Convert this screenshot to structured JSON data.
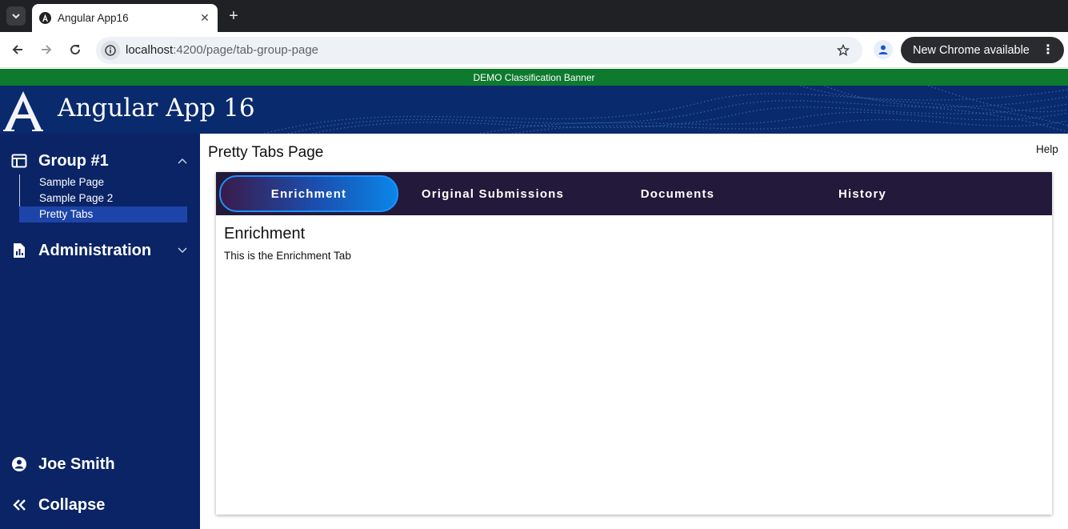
{
  "browser": {
    "tab_title": "Angular App16",
    "url_host": "localhost",
    "url_rest": ":4200/page/tab-group-page",
    "update_label": "New Chrome available"
  },
  "banner": {
    "text": "DEMO Classification Banner"
  },
  "header": {
    "title": "Angular App 16"
  },
  "sidebar": {
    "groups": [
      {
        "label": "Group #1",
        "icon": "dashboard-icon",
        "expanded": true,
        "items": [
          {
            "label": "Sample Page"
          },
          {
            "label": "Sample Page 2"
          },
          {
            "label": "Pretty Tabs",
            "active": true
          }
        ]
      },
      {
        "label": "Administration",
        "icon": "report-icon",
        "expanded": false
      }
    ],
    "user": {
      "label": "Joe Smith",
      "icon": "account-circle-icon"
    },
    "collapse": {
      "label": "Collapse",
      "icon": "double-chevron-left-icon"
    }
  },
  "page": {
    "title": "Pretty Tabs Page",
    "help_label": "Help"
  },
  "tabs": {
    "items": [
      {
        "label": "Enrichment",
        "active": true
      },
      {
        "label": "Original Submissions"
      },
      {
        "label": "Documents"
      },
      {
        "label": "History"
      }
    ],
    "panel": {
      "heading": "Enrichment",
      "text": "This is the Enrichment Tab"
    }
  },
  "colors": {
    "banner_green": "#0d7a2e",
    "header_navy": "#0a2a6e",
    "sidebar_navy": "#0a2466",
    "active_item": "#1d44a8",
    "tab_bar": "#23193a",
    "tab_active_border": "#1e90ff"
  }
}
